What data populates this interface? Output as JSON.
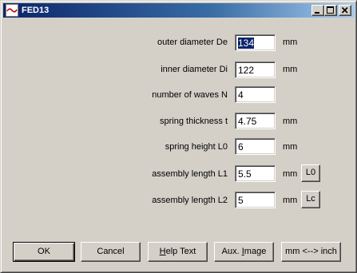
{
  "window": {
    "title": "FED13"
  },
  "fields": [
    {
      "label": "outer diameter De",
      "value": "134",
      "unit": "mm",
      "selected": true
    },
    {
      "label": "inner diameter Di",
      "value": "122",
      "unit": "mm"
    },
    {
      "label": "number of waves N",
      "value": "4",
      "unit": ""
    },
    {
      "label": "spring thickness t",
      "value": "4.75",
      "unit": "mm"
    },
    {
      "label": "spring height L0",
      "value": "6",
      "unit": "mm"
    },
    {
      "label": "assembly length L1",
      "value": "5.5",
      "unit": "mm",
      "button": "L0"
    },
    {
      "label": "assembly length L2",
      "value": "5",
      "unit": "mm",
      "button": "Lc"
    }
  ],
  "buttons": {
    "ok": "OK",
    "cancel": "Cancel",
    "help_prefix": "H",
    "help_rest": "elp Text",
    "aux_prefix": "Aux. ",
    "aux_underline": "I",
    "aux_rest": "mage",
    "units": "mm <--> inch"
  },
  "colors": {
    "title_gradient_start": "#0a246a",
    "title_gradient_end": "#a6caf0",
    "face": "#d4d0c8",
    "selection": "#0a246a"
  },
  "icons": {
    "app": "wave-spring-icon",
    "minimize": "minimize-icon",
    "maximize": "maximize-icon",
    "close": "close-icon"
  }
}
